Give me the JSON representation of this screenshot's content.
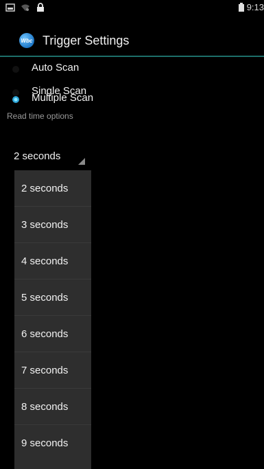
{
  "status_bar": {
    "time": "9:13",
    "left_icons": [
      "image-icon",
      "wifi-icon",
      "lock-icon"
    ],
    "battery_icon": "battery-icon"
  },
  "app": {
    "title": "Trigger Settings",
    "icon_text": "Wbc"
  },
  "scan_modes": [
    {
      "label": "Auto Scan",
      "checked": false
    },
    {
      "label": "Single Scan",
      "checked": false
    },
    {
      "label": "Multiple Scan",
      "checked": true
    }
  ],
  "read_time": {
    "label": "Read time options",
    "selected": "2 seconds",
    "options": [
      "2 seconds",
      "3 seconds",
      "4 seconds",
      "5 seconds",
      "6 seconds",
      "7 seconds",
      "8 seconds",
      "9 seconds"
    ]
  },
  "colors": {
    "background": "#000000",
    "accent": "#1d6f6a",
    "dropdown_bg": "#2e2e2e",
    "radio_checked": "#2ea6d9"
  }
}
